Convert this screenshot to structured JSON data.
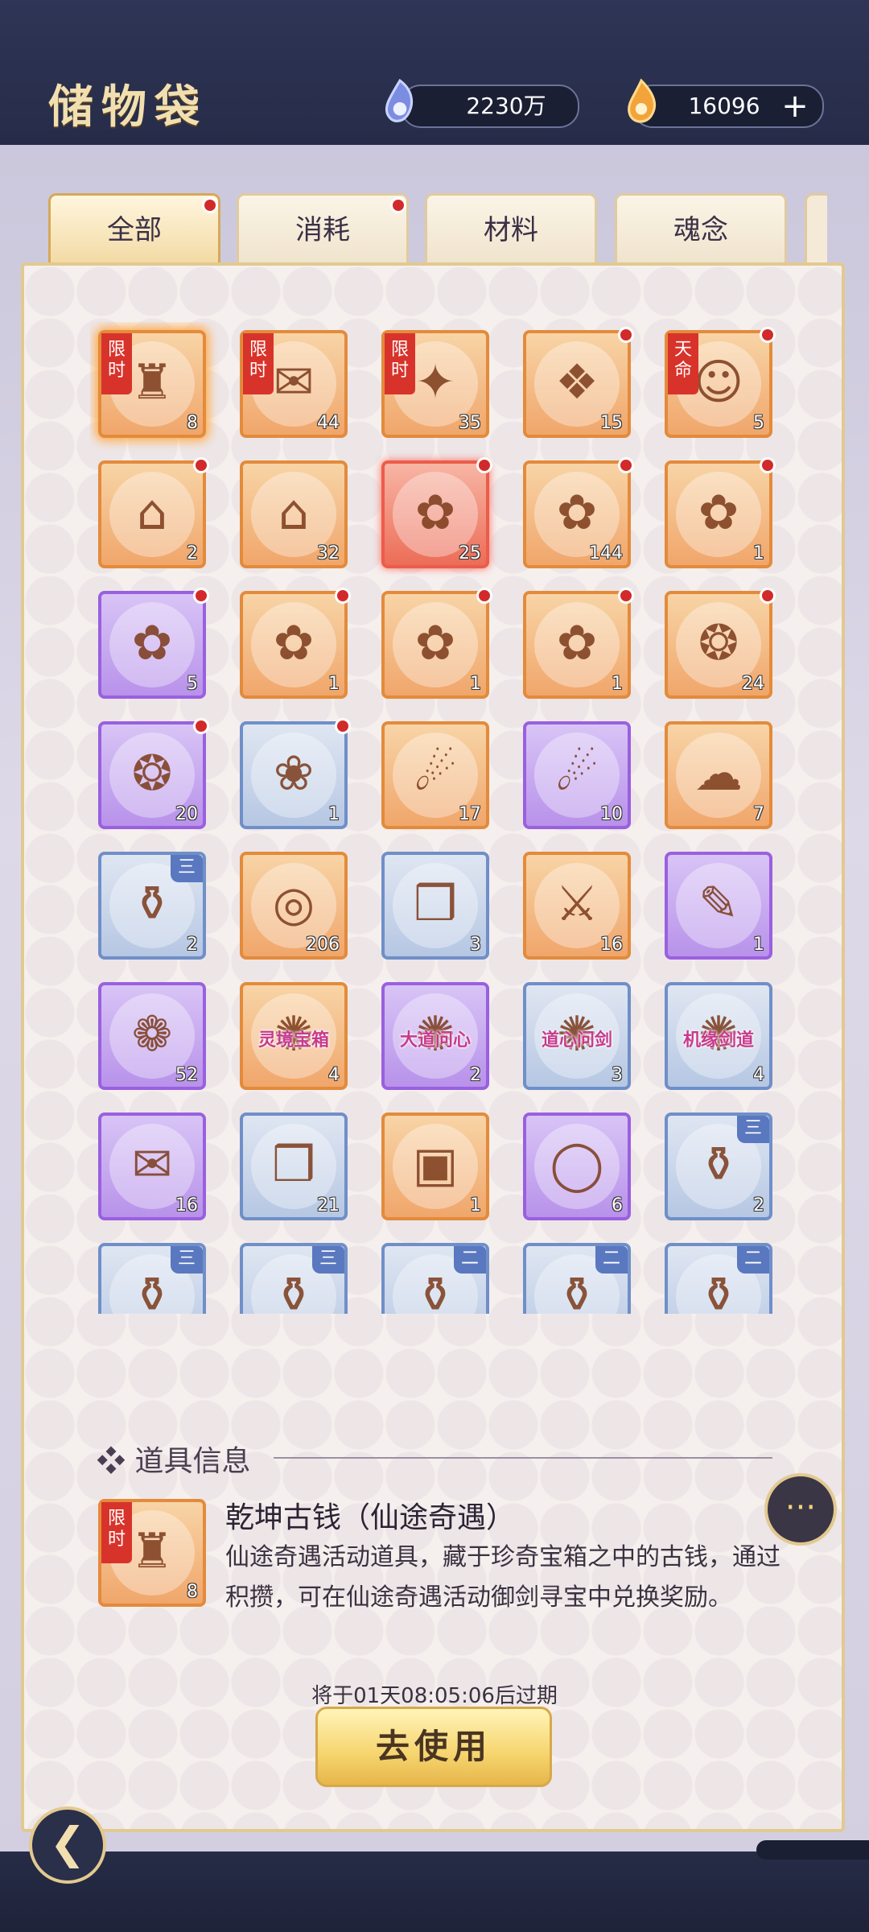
{
  "header": {
    "title": "储物袋",
    "currency1": {
      "icon": "spirit-stone-icon",
      "value": "2230万"
    },
    "currency2": {
      "icon": "flame-gem-icon",
      "value": "16096",
      "plus": "+"
    }
  },
  "tabs": [
    {
      "label": "全部",
      "active": true,
      "dot": true
    },
    {
      "label": "消耗",
      "active": false,
      "dot": true
    },
    {
      "label": "材料",
      "active": false,
      "dot": false
    },
    {
      "label": "魂念",
      "active": false,
      "dot": false
    }
  ],
  "items": [
    {
      "rarity": "orange",
      "count": "8",
      "tag": "限时",
      "dot": false,
      "selected": true,
      "glyph": "♜"
    },
    {
      "rarity": "orange",
      "count": "44",
      "tag": "限时",
      "dot": false,
      "glyph": "✉"
    },
    {
      "rarity": "orange",
      "count": "35",
      "tag": "限时",
      "dot": false,
      "glyph": "✦"
    },
    {
      "rarity": "orange",
      "count": "15",
      "dot": true,
      "glyph": "❖"
    },
    {
      "rarity": "orange",
      "count": "5",
      "tag": "天命",
      "dot": true,
      "glyph": "☺"
    },
    {
      "rarity": "orange",
      "count": "2",
      "dot": true,
      "glyph": "⌂"
    },
    {
      "rarity": "orange",
      "count": "32",
      "glyph": "⌂"
    },
    {
      "rarity": "red",
      "count": "25",
      "dot": true,
      "glyph": "✿"
    },
    {
      "rarity": "orange",
      "count": "144",
      "dot": true,
      "glyph": "✿"
    },
    {
      "rarity": "orange",
      "count": "1",
      "dot": true,
      "glyph": "✿"
    },
    {
      "rarity": "purple",
      "count": "5",
      "dot": true,
      "glyph": "✿"
    },
    {
      "rarity": "orange",
      "count": "1",
      "dot": true,
      "glyph": "✿"
    },
    {
      "rarity": "orange",
      "count": "1",
      "dot": true,
      "glyph": "✿"
    },
    {
      "rarity": "orange",
      "count": "1",
      "dot": true,
      "glyph": "✿"
    },
    {
      "rarity": "orange",
      "count": "24",
      "dot": true,
      "glyph": "❂"
    },
    {
      "rarity": "purple",
      "count": "20",
      "dot": true,
      "glyph": "❂"
    },
    {
      "rarity": "blue",
      "count": "1",
      "dot": true,
      "glyph": "❀"
    },
    {
      "rarity": "orange",
      "count": "17",
      "glyph": "☄"
    },
    {
      "rarity": "purple",
      "count": "10",
      "glyph": "☄"
    },
    {
      "rarity": "orange",
      "count": "7",
      "glyph": "☁"
    },
    {
      "rarity": "blue",
      "count": "2",
      "grade": "三",
      "glyph": "⚱"
    },
    {
      "rarity": "orange",
      "count": "206",
      "glyph": "◎"
    },
    {
      "rarity": "blue",
      "count": "3",
      "glyph": "❒"
    },
    {
      "rarity": "orange",
      "count": "16",
      "glyph": "⚔"
    },
    {
      "rarity": "purple",
      "count": "1",
      "glyph": "✎"
    },
    {
      "rarity": "purple",
      "count": "52",
      "glyph": "❁"
    },
    {
      "rarity": "orange",
      "count": "4",
      "label": "灵境宝箱",
      "glyph": "✺"
    },
    {
      "rarity": "purple",
      "count": "2",
      "label": "大道问心",
      "glyph": "✺"
    },
    {
      "rarity": "blue",
      "count": "3",
      "label": "道心问剑",
      "glyph": "✺"
    },
    {
      "rarity": "blue",
      "count": "4",
      "label": "机缘剑道",
      "glyph": "✺"
    },
    {
      "rarity": "purple",
      "count": "16",
      "glyph": "✉"
    },
    {
      "rarity": "blue",
      "count": "21",
      "glyph": "❒"
    },
    {
      "rarity": "orange",
      "count": "1",
      "glyph": "▣"
    },
    {
      "rarity": "purple",
      "count": "6",
      "glyph": "◯"
    },
    {
      "rarity": "blue",
      "count": "2",
      "grade": "三",
      "glyph": "⚱"
    },
    {
      "rarity": "blue",
      "count": "",
      "grade": "三",
      "glyph": "⚱"
    },
    {
      "rarity": "blue",
      "count": "",
      "grade": "三",
      "glyph": "⚱"
    },
    {
      "rarity": "blue",
      "count": "",
      "grade": "二",
      "glyph": "⚱"
    },
    {
      "rarity": "blue",
      "count": "",
      "grade": "二",
      "glyph": "⚱"
    },
    {
      "rarity": "blue",
      "count": "",
      "grade": "二",
      "glyph": "⚱"
    }
  ],
  "info": {
    "section_title": "❖ 道具信息",
    "item": {
      "tag": "限时",
      "count": "8",
      "glyph": "♜"
    },
    "name": "乾坤古钱（仙途奇遇）",
    "description": "仙途奇遇活动道具，藏于珍奇宝箱之中的古钱，通过积攒，可在仙途奇遇活动御剑寻宝中兑换奖励。",
    "expire": "将于01天08:05:06后过期",
    "use_button": "去使用"
  },
  "colors": {
    "orange": "#e38b3b",
    "purple": "#9a60df",
    "blue": "#6f8fc8",
    "red": "#ea5d4a",
    "gold": "#e2c98f"
  },
  "controls": {
    "chat_icon": "chat-bubble-icon",
    "back_icon": "back-arrow-icon",
    "chat_glyph": "···",
    "back_glyph": "❮"
  }
}
